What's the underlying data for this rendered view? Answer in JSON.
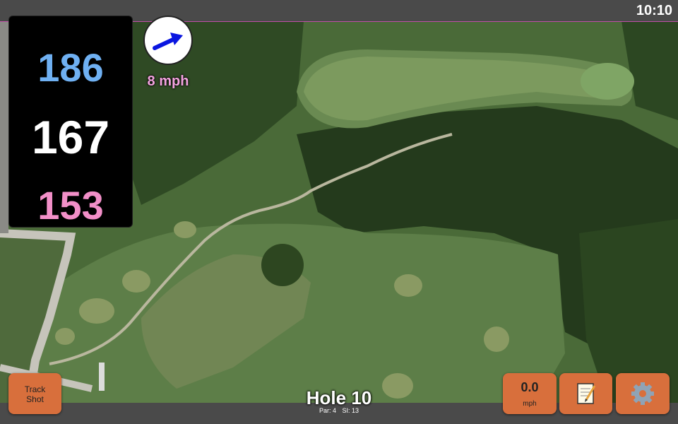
{
  "clock": "10:10",
  "distances": {
    "back": "186",
    "middle": "167",
    "front": "153",
    "colors": {
      "back": "#6fb0f2",
      "middle": "#ffffff",
      "front": "#f28fc8"
    }
  },
  "wind": {
    "speed_label": "8 mph",
    "direction_icon": "arrow-up-right-icon",
    "arrow_color": "#0a16e0"
  },
  "hole": {
    "title": "Hole 10",
    "par_label": "Par: 4",
    "si_label": "SI: 13"
  },
  "buttons": {
    "track_shot_line1": "Track",
    "track_shot_line2": "Shot",
    "speed_value": "0.0",
    "speed_unit": "mph",
    "notes_icon": "notepad-icon",
    "settings_icon": "gear-icon",
    "accent": "#d86f3c"
  },
  "map": {
    "view": "satellite",
    "accent_border": "#c04fa8"
  }
}
